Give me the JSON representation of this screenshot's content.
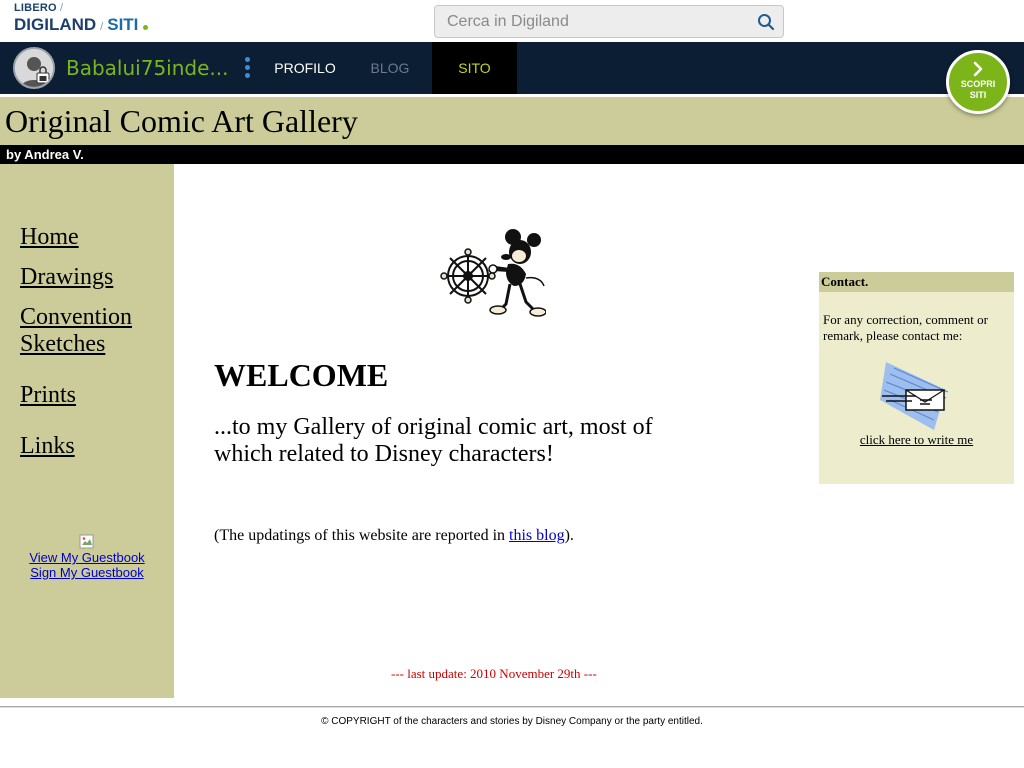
{
  "portal": {
    "logo_top": "LIBERO",
    "logo_digiland": "DIGILAND",
    "logo_siti": "SITI",
    "search_placeholder": "Cerca in Digiland"
  },
  "nav": {
    "username": "Babalui75inde...",
    "tabs": [
      {
        "label": "PROFILO",
        "active": false
      },
      {
        "label": "BLOG",
        "active": false
      },
      {
        "label": "SITO",
        "active": true
      }
    ],
    "scopri_line1": "SCOPRI",
    "scopri_line2": "SITI",
    "colors": {
      "nav_bg": "#0c1e33",
      "accent_green": "#7bb51a",
      "sito_text": "#c8d420"
    }
  },
  "site": {
    "title": "Original Comic Art Gallery",
    "byline": "by Andrea V."
  },
  "sidebar": {
    "links": [
      "Home",
      "Drawings",
      "Convention Sketches",
      "Prints",
      "Links"
    ],
    "guestbook_view": "View My Guestbook",
    "guestbook_sign": "Sign My Guestbook"
  },
  "main": {
    "welcome": "WELCOME",
    "intro": "...to my Gallery of original comic art, most of which related to Disney characters!",
    "update_prefix": "(The updatings of this website are reported in ",
    "update_link": "this blog",
    "update_suffix": ").",
    "last_update": "--- last update: 2010 November 29th ---"
  },
  "contact": {
    "heading": "Contact.",
    "text": "For any correction, comment or remark, please contact me:",
    "link": "click here to write me"
  },
  "footer": {
    "copyright": "© COPYRIGHT of the characters and stories by Disney Company or the party entitled."
  }
}
